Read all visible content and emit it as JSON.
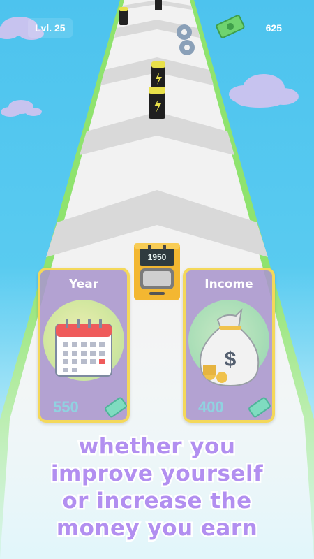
{
  "hud": {
    "level_label": "Lvl. 25",
    "money_value": "625",
    "money_icon": "cash-icon"
  },
  "device": {
    "year_display": "1950",
    "icon": "retro-computer-icon"
  },
  "cards": [
    {
      "title": "Year",
      "icon": "calendar-icon",
      "cost": "550",
      "cost_icon": "cash-icon"
    },
    {
      "title": "Income",
      "icon": "money-bag-icon",
      "cost": "400",
      "cost_icon": "cash-icon"
    }
  ],
  "caption": {
    "lines": [
      "Whether you",
      "improve yourself",
      "or increase the",
      "money you earn"
    ]
  },
  "colors": {
    "sky": "#52c6ee",
    "track": "#f1f1f1",
    "track_edge": "#8fe36e",
    "card_border": "#f4d85a",
    "caption_fill": "#b28ff0"
  }
}
